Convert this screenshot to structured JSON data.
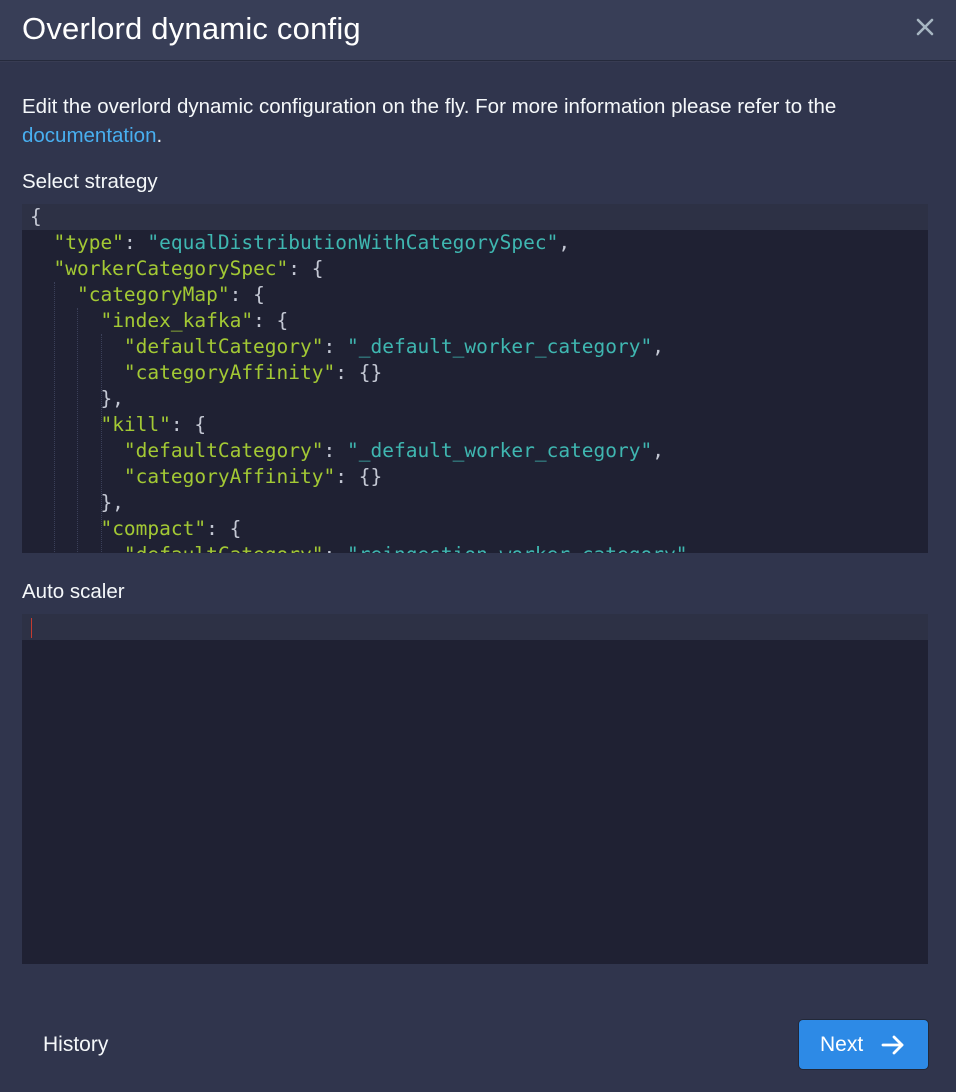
{
  "dialog": {
    "title": "Overlord dynamic config",
    "description_prefix": "Edit the overlord dynamic configuration on the fly. For more information please refer to the ",
    "doc_link_text": "documentation",
    "description_suffix": "."
  },
  "strategy": {
    "label": "Select strategy",
    "lines": [
      [
        [
          "p",
          "{"
        ]
      ],
      [
        [
          "p",
          "  "
        ],
        [
          "k",
          "\"type\""
        ],
        [
          "p",
          ": "
        ],
        [
          "s",
          "\"equalDistributionWithCategorySpec\""
        ],
        [
          "p",
          ","
        ]
      ],
      [
        [
          "p",
          "  "
        ],
        [
          "k",
          "\"workerCategorySpec\""
        ],
        [
          "p",
          ": {"
        ]
      ],
      [
        [
          "p",
          "    "
        ],
        [
          "k",
          "\"categoryMap\""
        ],
        [
          "p",
          ": {"
        ]
      ],
      [
        [
          "p",
          "      "
        ],
        [
          "k",
          "\"index_kafka\""
        ],
        [
          "p",
          ": {"
        ]
      ],
      [
        [
          "p",
          "        "
        ],
        [
          "k",
          "\"defaultCategory\""
        ],
        [
          "p",
          ": "
        ],
        [
          "s",
          "\"_default_worker_category\""
        ],
        [
          "p",
          ","
        ]
      ],
      [
        [
          "p",
          "        "
        ],
        [
          "k",
          "\"categoryAffinity\""
        ],
        [
          "p",
          ": {}"
        ]
      ],
      [
        [
          "p",
          "      },"
        ]
      ],
      [
        [
          "p",
          "      "
        ],
        [
          "k",
          "\"kill\""
        ],
        [
          "p",
          ": {"
        ]
      ],
      [
        [
          "p",
          "        "
        ],
        [
          "k",
          "\"defaultCategory\""
        ],
        [
          "p",
          ": "
        ],
        [
          "s",
          "\"_default_worker_category\""
        ],
        [
          "p",
          ","
        ]
      ],
      [
        [
          "p",
          "        "
        ],
        [
          "k",
          "\"categoryAffinity\""
        ],
        [
          "p",
          ": {}"
        ]
      ],
      [
        [
          "p",
          "      },"
        ]
      ],
      [
        [
          "p",
          "      "
        ],
        [
          "k",
          "\"compact\""
        ],
        [
          "p",
          ": {"
        ]
      ],
      [
        [
          "p",
          "        "
        ],
        [
          "k",
          "\"defaultCategory\""
        ],
        [
          "p",
          ": "
        ],
        [
          "s",
          "\"reingestion_worker_category\""
        ],
        [
          "p",
          ","
        ]
      ]
    ]
  },
  "auto_scaler": {
    "label": "Auto scaler",
    "lines": []
  },
  "footer": {
    "history_label": "History",
    "next_label": "Next"
  },
  "colors": {
    "accent": "#2d8ae6",
    "link": "#48aff0",
    "json_key": "#a3c934",
    "json_string": "#3fb7b1"
  },
  "icons": {
    "close": "close-icon",
    "next": "arrow-right-icon"
  }
}
